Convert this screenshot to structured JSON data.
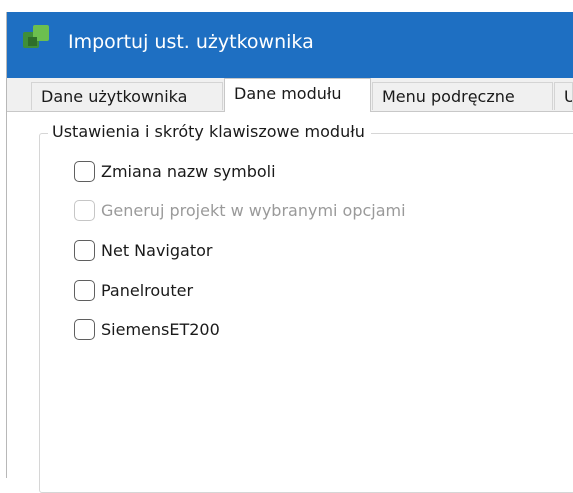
{
  "window": {
    "title": "Importuj ust. użytkownika",
    "icon": "app-icon",
    "titlebar_color": "#1e6fc2"
  },
  "tabs": [
    {
      "label": "Dane użytkownika",
      "active": false
    },
    {
      "label": "Dane modułu",
      "active": true
    },
    {
      "label": "Menu podręczne",
      "active": false
    },
    {
      "label": "U",
      "active": false
    }
  ],
  "group": {
    "legend": "Ustawienia i skróty klawiszowe modułu",
    "options": [
      {
        "label": "Zmiana nazw symboli",
        "checked": false,
        "enabled": true
      },
      {
        "label": "Generuj projekt w wybranymi opcjami",
        "checked": false,
        "enabled": false
      },
      {
        "label": "Net Navigator",
        "checked": false,
        "enabled": true
      },
      {
        "label": "Panelrouter",
        "checked": false,
        "enabled": true
      },
      {
        "label": "SiemensET200",
        "checked": false,
        "enabled": true
      }
    ]
  }
}
